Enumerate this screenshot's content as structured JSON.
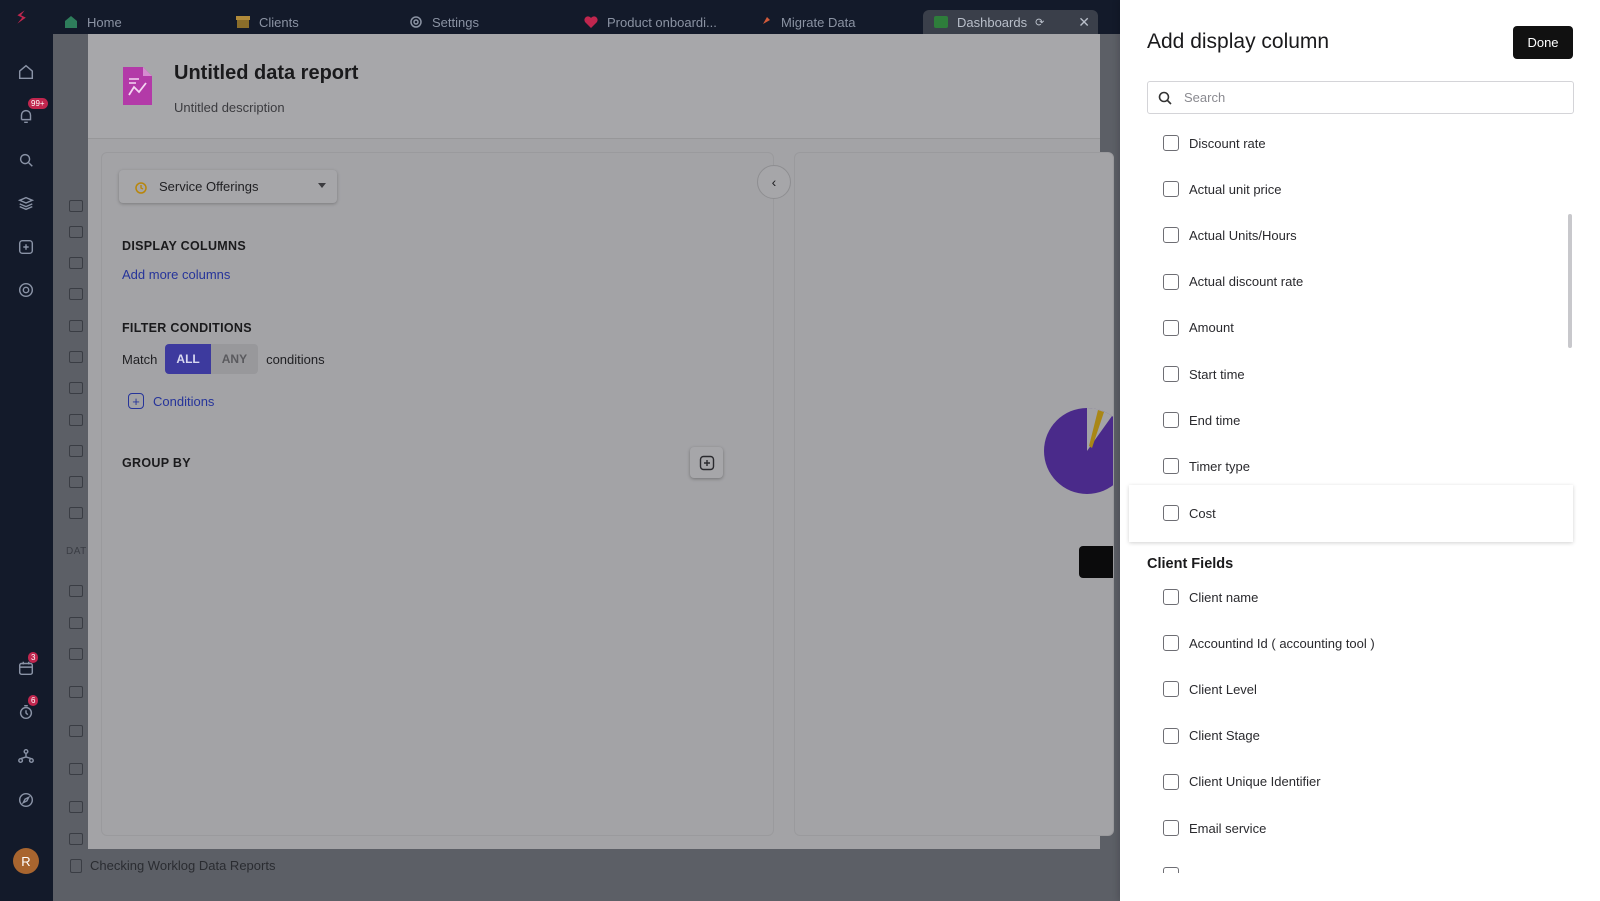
{
  "rail": {
    "notification_badge": "99+",
    "calendar_badge": "3",
    "timer_badge": "6",
    "avatar_initial": "R"
  },
  "tabs": [
    {
      "label": "Home",
      "icon": "home-icon"
    },
    {
      "label": "Clients",
      "icon": "store-icon"
    },
    {
      "label": "Settings",
      "icon": "gear-icon"
    },
    {
      "label": "Product onboardi...",
      "icon": "heart-icon"
    },
    {
      "label": "Migrate Data",
      "icon": "rocket-icon"
    },
    {
      "label": "Dashboards",
      "icon": "dashboard-icon",
      "active": true
    }
  ],
  "background": {
    "sidebar_section_label": "DAT",
    "bottom_item": "Checking Worklog Data Reports"
  },
  "report": {
    "title": "Untitled data report",
    "description": "Untitled description",
    "source_select": "Service Offerings",
    "display_columns_title": "DISPLAY COLUMNS",
    "add_more_columns": "Add more columns",
    "filter_title": "FILTER CONDITIONS",
    "match_label": "Match",
    "match_all": "ALL",
    "match_any": "ANY",
    "conditions_suffix": "conditions",
    "conditions_link": "Conditions",
    "group_by_title": "GROUP BY"
  },
  "drawer": {
    "title": "Add display column",
    "done_label": "Done",
    "search_placeholder": "Search",
    "service_options": [
      "Discount rate",
      "Actual unit price",
      "Actual Units/Hours",
      "Actual discount rate",
      "Amount",
      "Start time",
      "End time",
      "Timer type",
      "Cost"
    ],
    "client_group_title": "Client Fields",
    "client_options": [
      "Client name",
      "Accountind Id ( accounting tool )",
      "Client Level",
      "Client Stage",
      "Client Unique Identifier",
      "Email service"
    ]
  },
  "colors": {
    "accent": "#3d3a9e",
    "link": "#26349a",
    "brand_logo": "#c0264e",
    "pie_purple": "#5b21b6",
    "pie_yellow": "#d4a017"
  }
}
